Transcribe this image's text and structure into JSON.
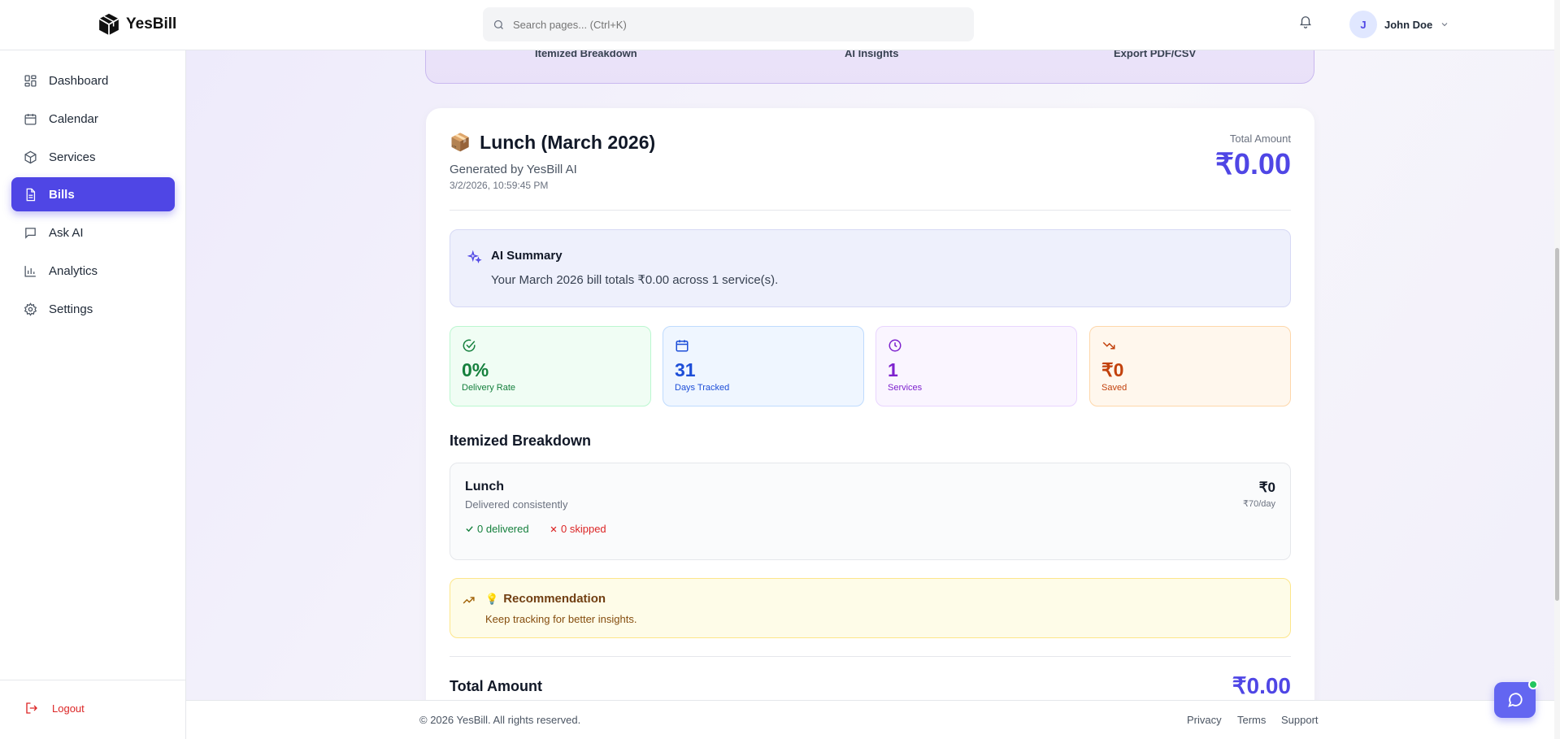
{
  "app": {
    "name": "YesBill"
  },
  "search": {
    "placeholder": "Search pages... (Ctrl+K)"
  },
  "user": {
    "initial": "J",
    "name": "John Doe"
  },
  "sidebar": {
    "items": [
      {
        "label": "Dashboard",
        "icon": "dashboard-icon"
      },
      {
        "label": "Calendar",
        "icon": "calendar-icon"
      },
      {
        "label": "Services",
        "icon": "box-icon"
      },
      {
        "label": "Bills",
        "icon": "file-icon",
        "active": true
      },
      {
        "label": "Ask AI",
        "icon": "chat-icon"
      },
      {
        "label": "Analytics",
        "icon": "bar-chart-icon"
      },
      {
        "label": "Settings",
        "icon": "gear-icon"
      }
    ],
    "logout_label": "Logout"
  },
  "features": [
    "Itemized Breakdown",
    "AI Insights",
    "Export PDF/CSV"
  ],
  "bill": {
    "emoji": "📦",
    "title": "Lunch (March 2026)",
    "generated_by": "Generated by YesBill AI",
    "timestamp": "3/2/2026, 10:59:45 PM",
    "total_label": "Total Amount",
    "total_amount": "₹0.00"
  },
  "ai_summary": {
    "title": "AI Summary",
    "text": "Your March 2026 bill totals ₹0.00 across 1 service(s)."
  },
  "stats": [
    {
      "value": "0%",
      "label": "Delivery Rate",
      "icon": "check-circle-icon",
      "color": "#15803d"
    },
    {
      "value": "31",
      "label": "Days Tracked",
      "icon": "calendar-icon",
      "color": "#1d4ed8"
    },
    {
      "value": "1",
      "label": "Services",
      "icon": "clock-icon",
      "color": "#7e22ce"
    },
    {
      "value": "₹0",
      "label": "Saved",
      "icon": "trending-down-icon",
      "color": "#c2410c"
    }
  ],
  "breakdown": {
    "title": "Itemized Breakdown",
    "item": {
      "name": "Lunch",
      "subtitle": "Delivered consistently",
      "delivered": "0 delivered",
      "skipped": "0 skipped",
      "amount": "₹0",
      "rate": "₹70/day"
    }
  },
  "recommendation": {
    "emoji": "💡",
    "title": "Recommendation",
    "text": "Keep tracking for better insights."
  },
  "bottom_total": {
    "label": "Total Amount",
    "value": "₹0.00"
  },
  "footer": {
    "copyright": "© 2026 YesBill. All rights reserved.",
    "links": [
      "Privacy",
      "Terms",
      "Support"
    ]
  }
}
